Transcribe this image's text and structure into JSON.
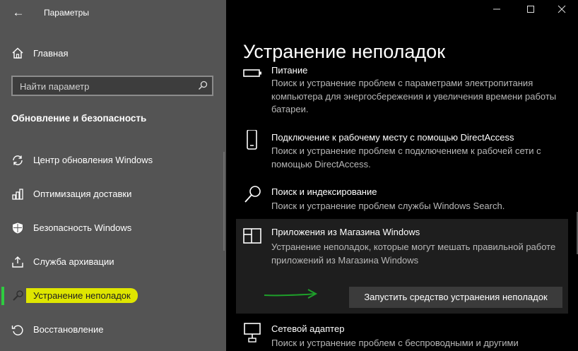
{
  "window": {
    "title": "Параметры",
    "back": "←",
    "controls": {
      "minimize": "—",
      "maximize": "☐",
      "close": "✕"
    }
  },
  "sidebar": {
    "home_label": "Главная",
    "search_placeholder": "Найти параметр",
    "section_title": "Обновление и безопасность",
    "items": [
      {
        "label": "Центр обновления Windows",
        "icon": "sync-icon"
      },
      {
        "label": "Оптимизация доставки",
        "icon": "delivery-icon"
      },
      {
        "label": "Безопасность Windows",
        "icon": "shield-icon"
      },
      {
        "label": "Служба архивации",
        "icon": "backup-icon"
      },
      {
        "label": "Устранение неполадок",
        "icon": "wrench-icon",
        "active": true
      },
      {
        "label": "Восстановление",
        "icon": "recovery-icon"
      }
    ],
    "active_highlight_color": "#dfe600",
    "active_bar_color": "#2ecc40"
  },
  "main": {
    "title": "Устранение неполадок",
    "tiles": [
      {
        "title": "Питание",
        "desc": "Поиск и устранение проблем с параметрами электропитания компьютера для энергосбережения и увеличения  времени работы батареи.",
        "icon": "battery-icon"
      },
      {
        "title": "Подключение к рабочему месту с помощью DirectAccess",
        "desc": "Поиск и устранение проблем с подключением к рабочей сети с помощью DirectAccess.",
        "icon": "phone-icon"
      },
      {
        "title": "Поиск и индексирование",
        "desc": "Поиск и устранение проблем службы Windows Search.",
        "icon": "search-icon"
      },
      {
        "title": "Приложения из Магазина Windows",
        "desc": "Устранение неполадок, которые могут мешать правильной работе приложений из Магазина Windows",
        "icon": "store-app-icon",
        "button": "Запустить средство устранения неполадок"
      },
      {
        "title": "Сетевой адаптер",
        "desc": "Поиск и устранение проблем с беспроводными и другими",
        "icon": "network-icon"
      }
    ],
    "arrow_color": "#1e9e2a"
  }
}
